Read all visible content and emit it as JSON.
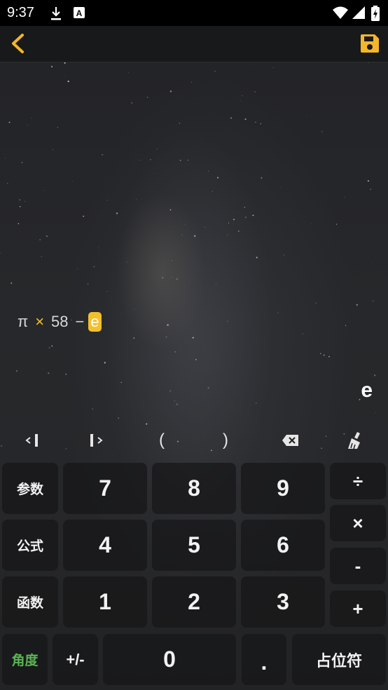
{
  "status_bar": {
    "time": "9:37",
    "icons": [
      "download-icon",
      "a-notification-icon",
      "wifi-icon",
      "signal-icon",
      "battery-charging-icon"
    ]
  },
  "top_bar": {
    "back_icon": "chevron-left-icon",
    "save_icon": "save-icon",
    "accent": "#f3b62b"
  },
  "expression": {
    "pi": "π",
    "times": "×",
    "number": "58",
    "minus": "−",
    "cursor_token": "e"
  },
  "result": "e",
  "toolbar": {
    "left": "cursor-left-icon",
    "right": "cursor-right-icon",
    "open_paren": "(",
    "close_paren": ")",
    "backspace": "backspace-icon",
    "clear": "broom-icon"
  },
  "keys": {
    "params": "参数",
    "formula": "公式",
    "function": "函数",
    "angle": "角度",
    "n7": "7",
    "n8": "8",
    "n9": "9",
    "n4": "4",
    "n5": "5",
    "n6": "6",
    "n1": "1",
    "n2": "2",
    "n3": "3",
    "sign": "+/-",
    "n0": "0",
    "dot": ".",
    "placeholder": "占位符",
    "divide": "÷",
    "multiply": "×",
    "subtract": "-",
    "add": "+"
  },
  "colors": {
    "token_bg": "#f3c02c",
    "angle_text": "#5ab553",
    "operator_yellow": "#f2c230"
  }
}
